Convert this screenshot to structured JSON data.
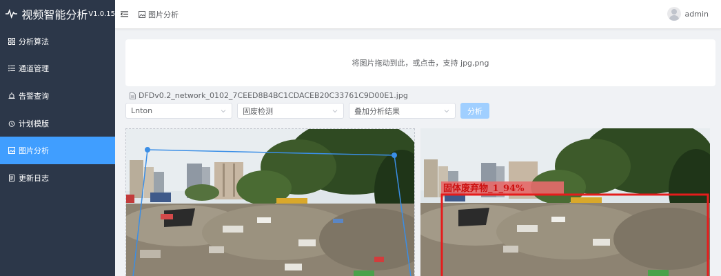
{
  "app": {
    "title": "视频智能分析",
    "version": "V1.0.15"
  },
  "sidebar": {
    "items": [
      {
        "label": "分析算法",
        "icon": "grid-icon",
        "active": false
      },
      {
        "label": "通道管理",
        "icon": "list-icon",
        "active": false
      },
      {
        "label": "告警查询",
        "icon": "alarm-icon",
        "active": false
      },
      {
        "label": "计划模版",
        "icon": "clock-icon",
        "active": false
      },
      {
        "label": "图片分析",
        "icon": "picture-icon",
        "active": true
      },
      {
        "label": "更新日志",
        "icon": "document-icon",
        "active": false
      }
    ]
  },
  "header": {
    "breadcrumb": "图片分析",
    "username": "admin"
  },
  "upload": {
    "hint": "将图片拖动到此，或点击，支持 jpg,png"
  },
  "file": {
    "name": "DFDv0.2_network_0102_7CEED8B4BC1CDACEB20C33761C9D00E1.jpg"
  },
  "controls": {
    "model_select": "Lnton",
    "detect_select": "固废检测",
    "overlay_select": "叠加分析结果",
    "analyze_button": "分析"
  },
  "result": {
    "label": "固体废弃物_1_94%"
  },
  "colors": {
    "sidebar_bg": "#2c3749",
    "accent": "#409eff",
    "polygon": "#3a8ee6",
    "detection_box": "#e51c1c"
  }
}
